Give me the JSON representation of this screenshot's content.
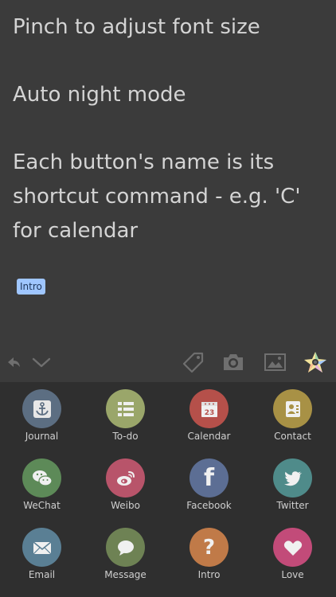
{
  "editor": {
    "line1": "Pinch to adjust font size",
    "line2": "Auto night mode",
    "line3": "Each button's name is its shortcut command - e.g. 'C' for calendar",
    "tag": "Intro"
  },
  "toolbar": {
    "left_icons": [
      "undo-icon",
      "chevron-down-icon"
    ],
    "right_icons": [
      "tag-icon",
      "camera-icon",
      "image-icon",
      "star-palette-icon"
    ]
  },
  "shortcuts": [
    {
      "label": "Journal",
      "color": "#5c6e82",
      "icon": "anchor-icon"
    },
    {
      "label": "To-do",
      "color": "#9aa66a",
      "icon": "list-icon"
    },
    {
      "label": "Calendar",
      "color": "#b5504a",
      "icon": "calendar-icon",
      "badge": "23"
    },
    {
      "label": "Contact",
      "color": "#a89145",
      "icon": "contact-card-icon"
    },
    {
      "label": "WeChat",
      "color": "#5d8a58",
      "icon": "wechat-icon"
    },
    {
      "label": "Weibo",
      "color": "#b8546a",
      "icon": "weibo-icon"
    },
    {
      "label": "Facebook",
      "color": "#5c6e94",
      "icon": "facebook-icon",
      "glyph": "f"
    },
    {
      "label": "Twitter",
      "color": "#4f8b8a",
      "icon": "twitter-icon"
    },
    {
      "label": "Email",
      "color": "#5a7f94",
      "icon": "envelope-icon"
    },
    {
      "label": "Message",
      "color": "#6e8254",
      "icon": "speech-bubble-icon"
    },
    {
      "label": "Intro",
      "color": "#c07a48",
      "icon": "question-icon",
      "glyph": "?"
    },
    {
      "label": "Love",
      "color": "#c24b79",
      "icon": "heart-icon"
    }
  ]
}
